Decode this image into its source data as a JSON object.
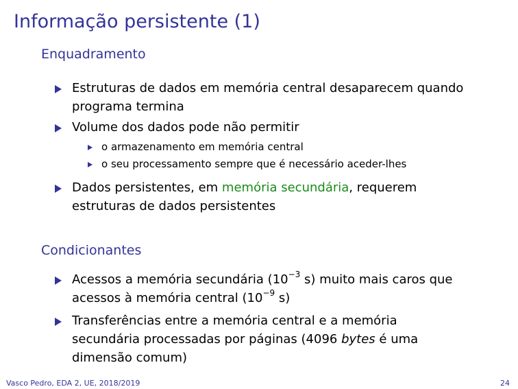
{
  "slide": {
    "title": "Informação persistente (1)",
    "sections": {
      "enquadramento": {
        "heading": "Enquadramento",
        "bullet1_line1": "Estruturas de dados em memória central desaparecem quando",
        "bullet1_line2": "programa termina",
        "bullet2": "Volume dos dados pode não permitir",
        "sub1": "o armazenamento em memória central",
        "sub2": "o seu processamento sempre que é necessário aceder-lhes",
        "bullet3_pre": "Dados persistentes, em ",
        "bullet3_highlight": "memória secundária",
        "bullet3_post": ", requerem",
        "bullet3_line2": "estruturas de dados persistentes"
      },
      "condicionantes": {
        "heading": "Condicionantes",
        "bullet1_pre": "Acessos a memória secundária (10",
        "bullet1_exp": "−3",
        "bullet1_post": " s) muito mais caros que",
        "bullet1_line2_pre": "acessos à memória central (10",
        "bullet1_line2_exp": "−9",
        "bullet1_line2_post": " s)",
        "bullet2_line1": "Transferências entre a memória central e a memória",
        "bullet2_line2_pre": "secundária processadas por páginas (4096 ",
        "bullet2_line2_italic": "bytes",
        "bullet2_line2_post": " é uma",
        "bullet2_line3": "dimensão comum)"
      }
    },
    "footer": {
      "left": "Vasco Pedro, EDA 2, UE, 2018/2019",
      "page": "24"
    }
  },
  "colors": {
    "heading": "#33339a",
    "highlight": "#1a8a1a"
  }
}
